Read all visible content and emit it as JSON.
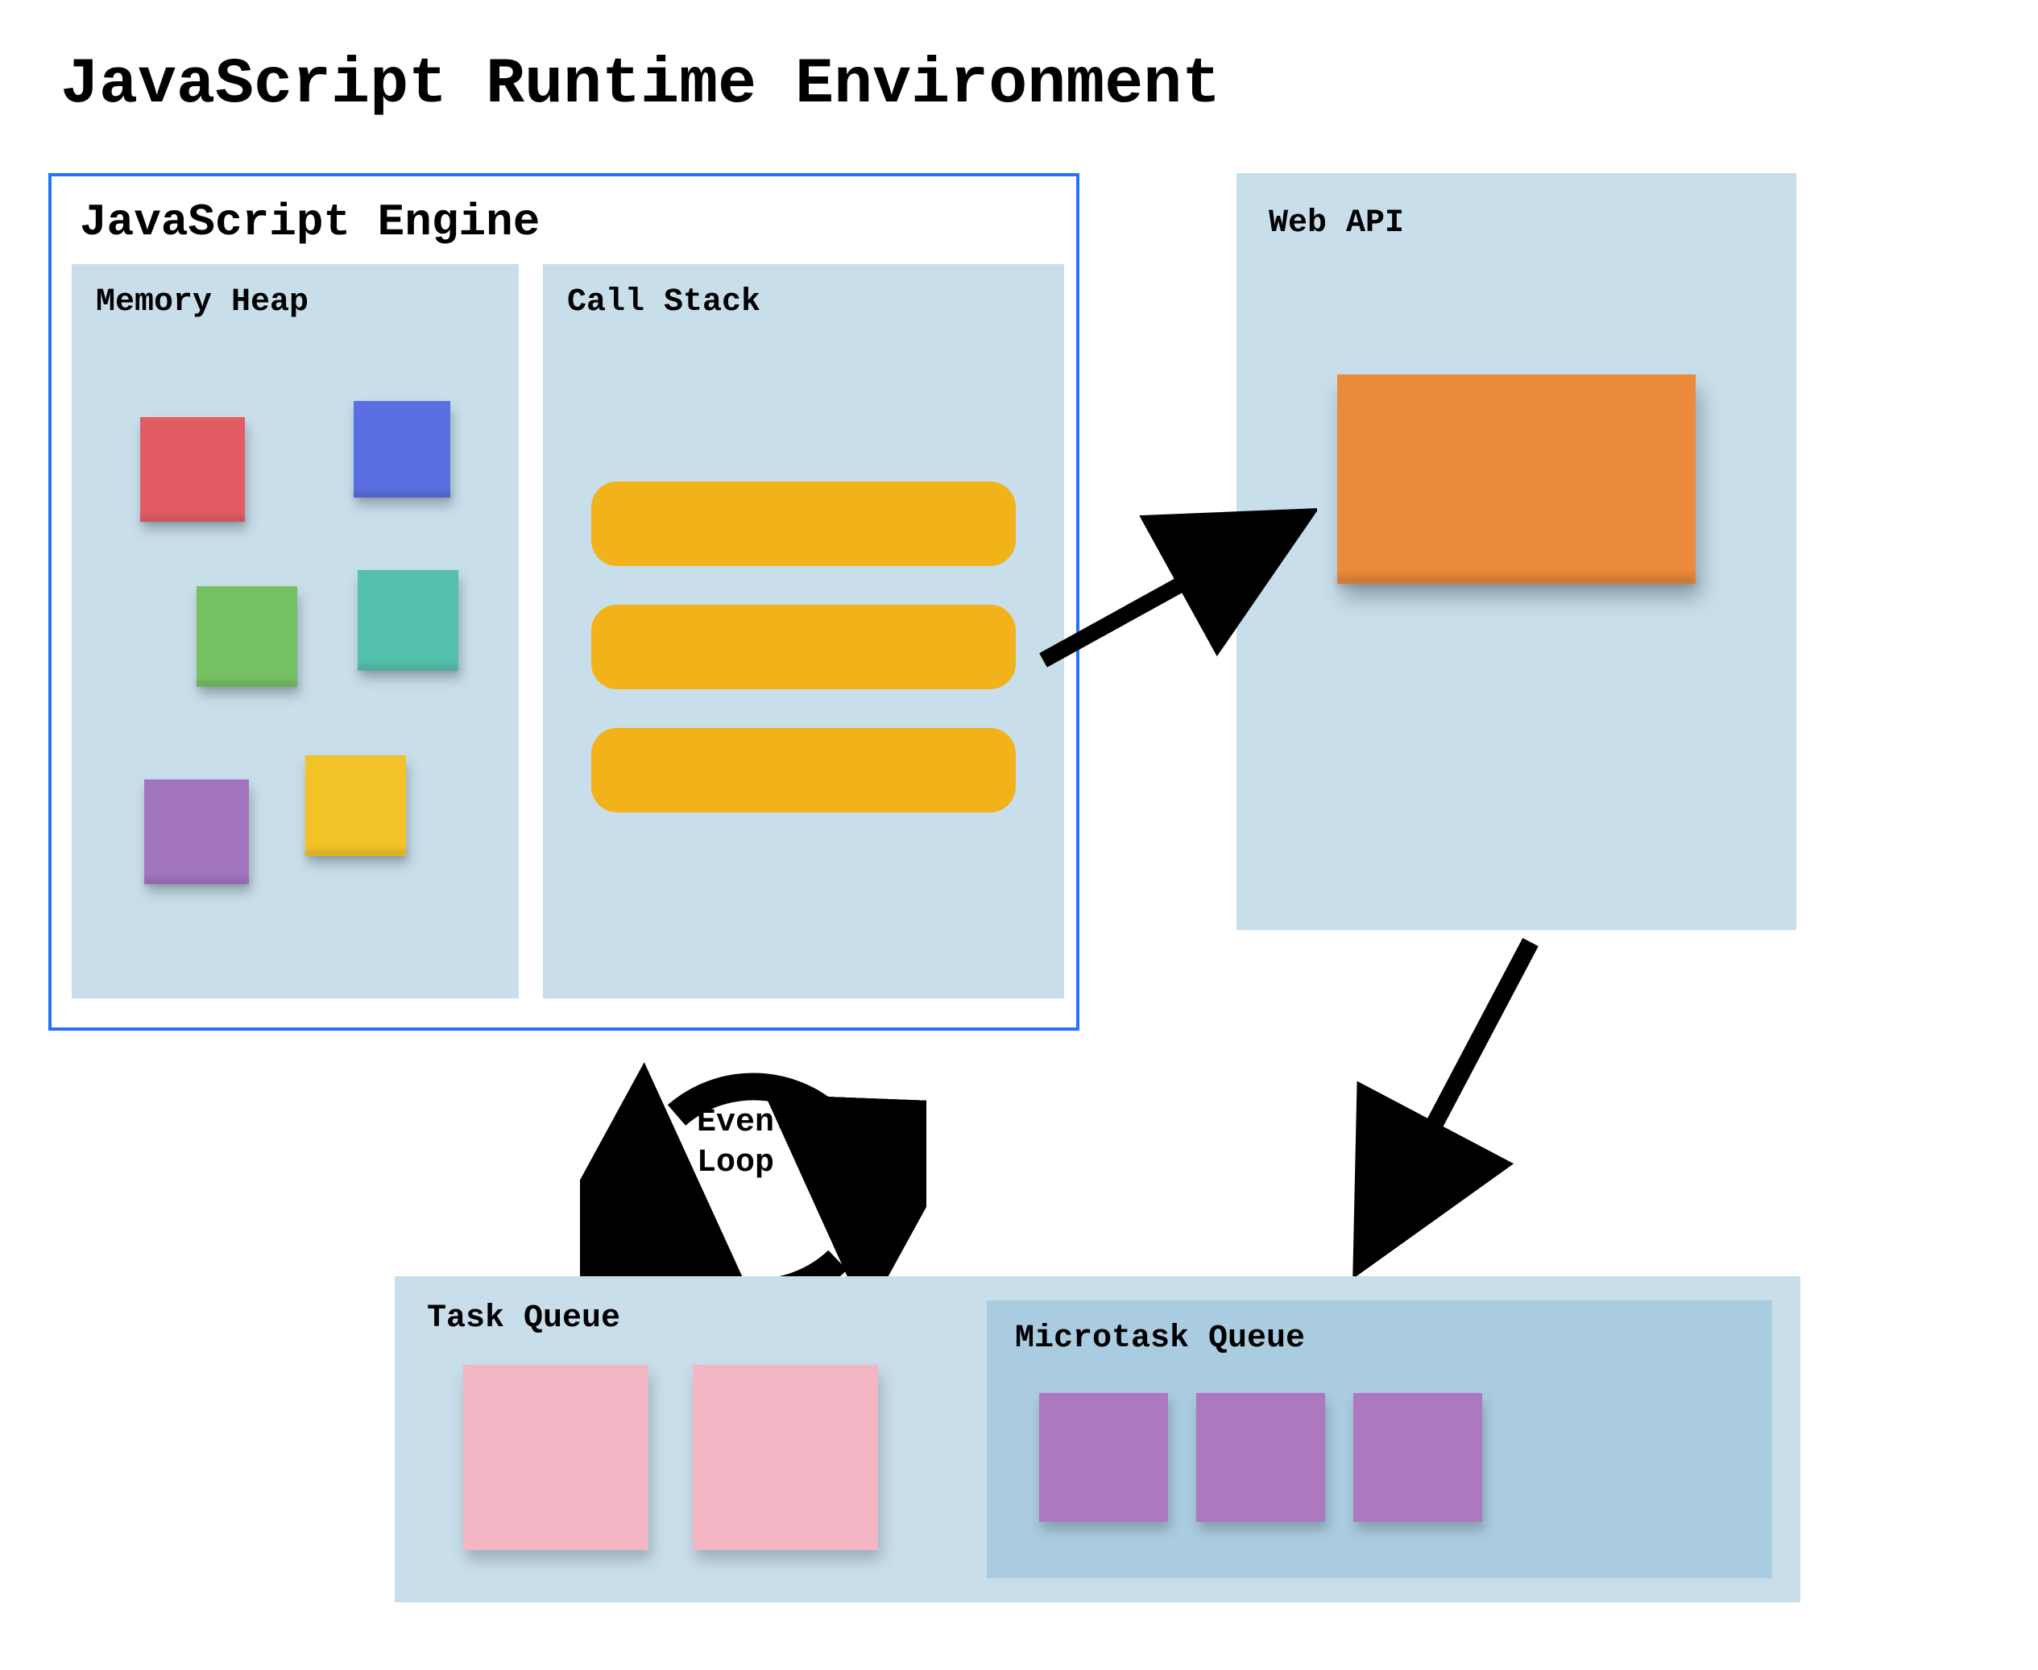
{
  "title": "JavaScript Runtime Environment",
  "engine": {
    "title": "JavaScript Engine",
    "memory_heap": {
      "label": "Memory Heap",
      "notes": [
        {
          "name": "note-red",
          "color": "#e35c64"
        },
        {
          "name": "note-blue",
          "color": "#5a6fe2"
        },
        {
          "name": "note-green",
          "color": "#74c164"
        },
        {
          "name": "note-teal",
          "color": "#55c0ac"
        },
        {
          "name": "note-yellow",
          "color": "#f2c227"
        },
        {
          "name": "note-purple",
          "color": "#a274c0"
        }
      ]
    },
    "call_stack": {
      "label": "Call Stack",
      "frame_count": 3,
      "frame_color": "#f1b21a"
    }
  },
  "web_api": {
    "label": "Web API",
    "card_color": "#ea8a3a"
  },
  "event_loop": {
    "label_line1": "Event",
    "label_line2": "Loop"
  },
  "task_queue": {
    "label": "Task Queue",
    "note_count": 2,
    "note_color": "#f3b6c4"
  },
  "microtask_queue": {
    "label": "Microtask Queue",
    "note_count": 3,
    "note_color": "#ad77c1"
  },
  "arrows": {
    "callstack_to_webapi": true,
    "webapi_to_microtask": true,
    "event_loop_cycle": true
  },
  "palette": {
    "panel_bg": "#c8dfeb",
    "micro_panel_bg": "#aacce0",
    "engine_border": "#2573f6",
    "arrow": "#000000"
  }
}
